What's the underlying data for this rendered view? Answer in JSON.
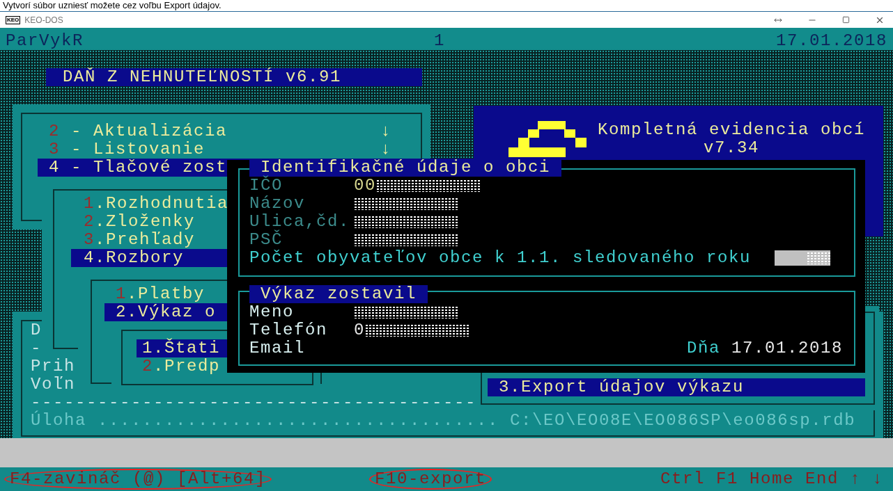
{
  "caption": "Vytvorí súbor uzniesť možete cez voľbu Export údajov.",
  "window": {
    "logo_text": "KEO",
    "title": "KEO-DOS"
  },
  "header": {
    "program": "ParVykR",
    "page": "1",
    "date": "17.01.2018"
  },
  "app_title": "DAŇ Z NEHNUTEĽNOSTÍ v6.91",
  "main_menu": [
    {
      "number": "2",
      "label": "- Aktualizácia",
      "arrow": "↓",
      "selected": false
    },
    {
      "number": "3",
      "label": "- Listovanie",
      "arrow": "↓",
      "selected": false
    },
    {
      "number": "4",
      "label": "- Tlačové zost",
      "selected": true
    }
  ],
  "info_box": {
    "title": "Kompletná evidencia obcí",
    "version": "v7.34"
  },
  "background_panel": {
    "lines": [
      "D",
      "-",
      "Prih",
      "Voľn",
      "----------------------------------------"
    ],
    "task_line": "Úloha .................................... C:\\EO\\EO08E\\EO086SP\\eo086sp.rdb"
  },
  "submenu_1": [
    {
      "number": "1",
      "label": ".Rozhodnutia",
      "selected": false
    },
    {
      "number": "2",
      "label": ".Zloženky",
      "selected": false
    },
    {
      "number": "3",
      "label": ".Prehľady",
      "selected": false
    },
    {
      "number": "4",
      "label": ".Rozbory",
      "selected": true
    }
  ],
  "submenu_2": [
    {
      "number": "1",
      "label": ".Platby",
      "selected": false
    },
    {
      "number": "2",
      "label": ".Výkaz o",
      "selected": true
    }
  ],
  "submenu_3": [
    {
      "number": "1",
      "label": ".Štati",
      "selected": true
    },
    {
      "number": "2",
      "label": ".Predp",
      "selected": false
    }
  ],
  "export_menu": [
    {
      "number": "3",
      "label": ".Export údajov výkazu",
      "selected": true
    }
  ],
  "dialog": {
    "section_1": {
      "title": "Identifikačné údaje o obci",
      "fields": [
        {
          "label": "IČO",
          "value": "00",
          "redacted": true
        },
        {
          "label": "Názov",
          "redacted": true
        },
        {
          "label": "Ulica,čd.",
          "redacted": true
        },
        {
          "label": "PSČ",
          "redacted": true
        }
      ],
      "population": {
        "label": "Počet obyvateľov obce k 1.1. sledovaného roku",
        "redacted": true
      }
    },
    "section_2": {
      "title": "Výkaz zostavil",
      "fields": [
        {
          "label": "Meno",
          "redacted": true
        },
        {
          "label": "Telefón",
          "value": "0",
          "redacted": true
        },
        {
          "label": "Email"
        }
      ],
      "date_label": "Dňa",
      "date": "17.01.2018"
    }
  },
  "status_bar": [
    {
      "text": "F4-zavináč (@) [Alt+64]",
      "circled": true
    },
    {
      "text": "F10-export",
      "circled": true
    },
    {
      "text": "Ctrl F1 Home End ↑ ↓",
      "circled": false
    }
  ]
}
